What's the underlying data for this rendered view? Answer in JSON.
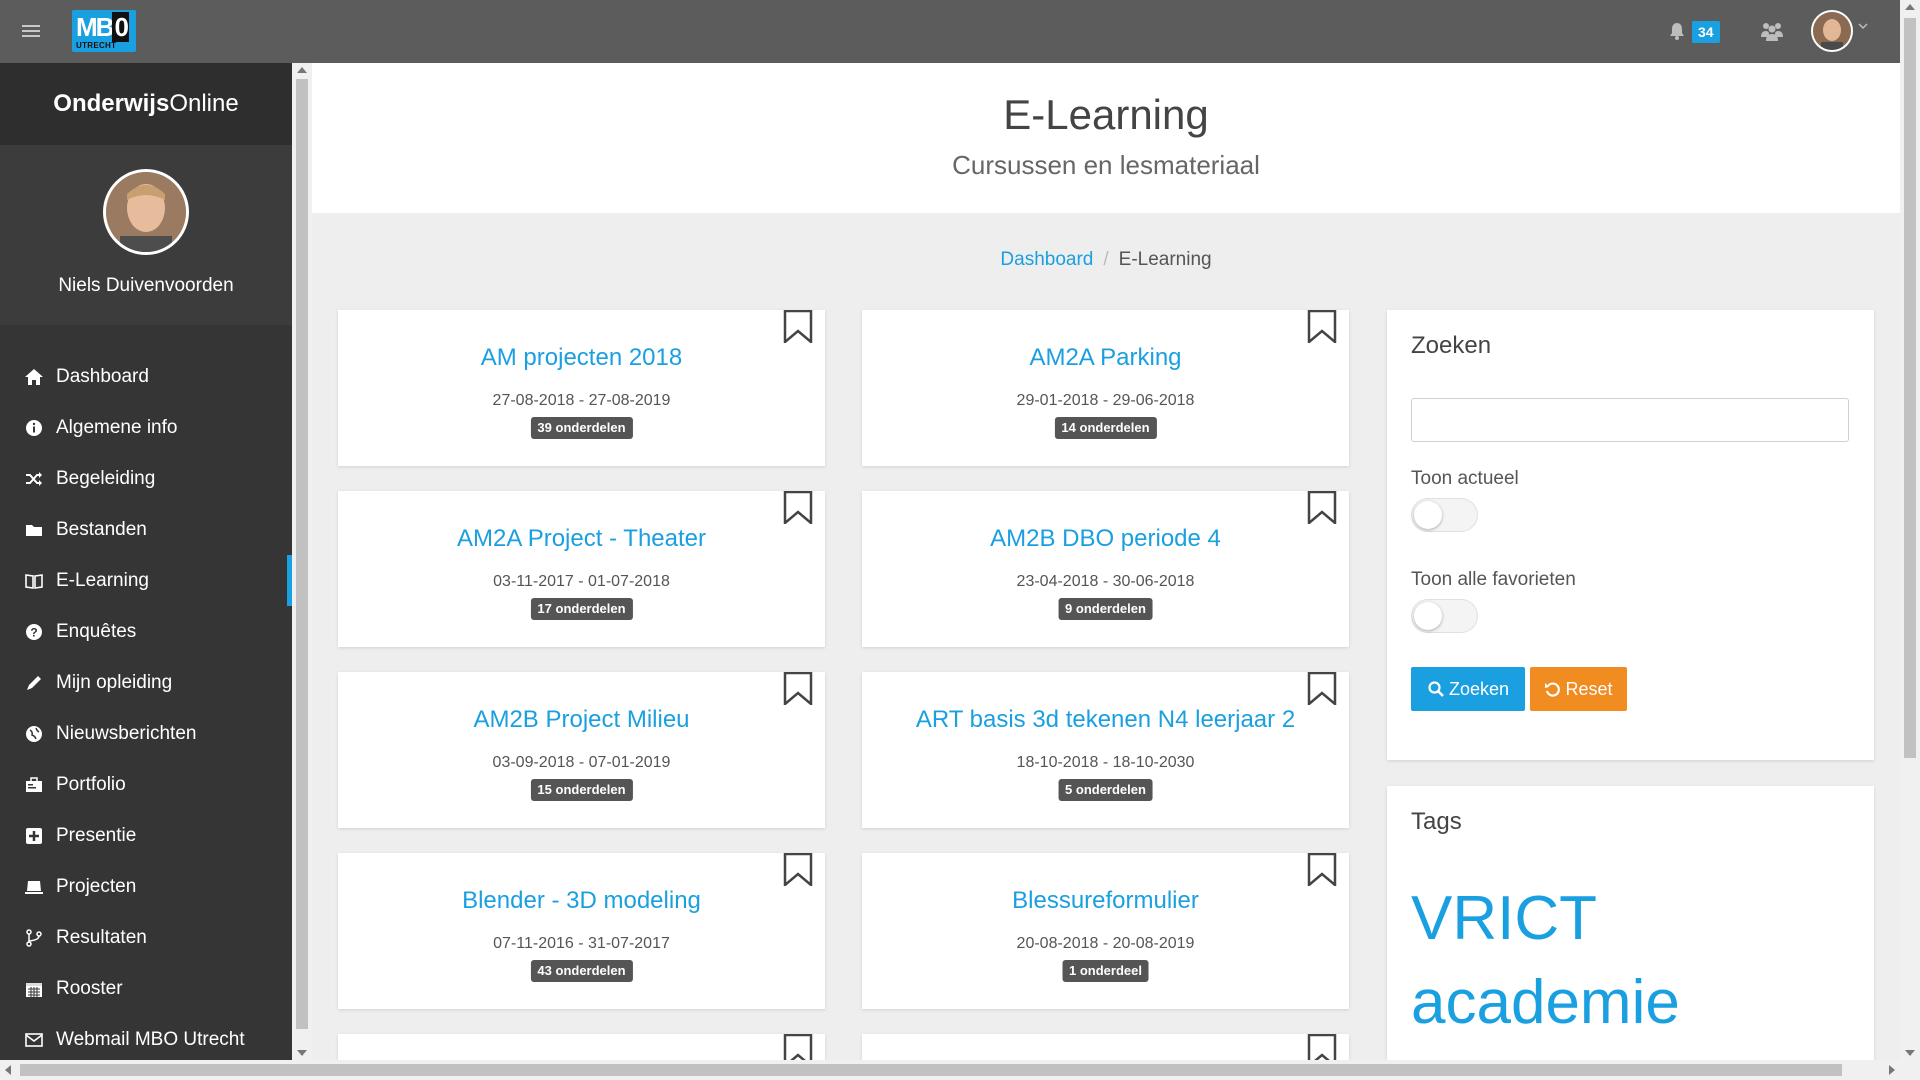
{
  "topbar": {
    "logo_text_main": "MB",
    "logo_text_zero": "0",
    "logo_text_sub": "UTRECHT",
    "notification_count": "34",
    "accent_color": "#1a9fe0",
    "icons": [
      "menu-icon",
      "bell-icon",
      "users-icon",
      "user-avatar",
      "chevron-down-icon"
    ]
  },
  "sidebar": {
    "brand_bold": "Onderwijs",
    "brand_light": "Online",
    "user_name": "Niels Duivenvoorden",
    "items": [
      {
        "label": "Dashboard",
        "icon": "home-icon"
      },
      {
        "label": "Algemene info",
        "icon": "info-icon"
      },
      {
        "label": "Begeleiding",
        "icon": "shuffle-icon"
      },
      {
        "label": "Bestanden",
        "icon": "folder-icon"
      },
      {
        "label": "E-Learning",
        "icon": "book-icon",
        "active": true
      },
      {
        "label": "Enquêtes",
        "icon": "question-icon"
      },
      {
        "label": "Mijn opleiding",
        "icon": "pencil-icon"
      },
      {
        "label": "Nieuwsberichten",
        "icon": "globe-icon"
      },
      {
        "label": "Portfolio",
        "icon": "briefcase-icon"
      },
      {
        "label": "Presentie",
        "icon": "plus-square-icon"
      },
      {
        "label": "Projecten",
        "icon": "laptop-icon"
      },
      {
        "label": "Resultaten",
        "icon": "branch-icon"
      },
      {
        "label": "Rooster",
        "icon": "calendar-icon"
      },
      {
        "label": "Webmail MBO Utrecht",
        "icon": "envelope-icon"
      }
    ]
  },
  "header": {
    "title": "E-Learning",
    "subtitle": "Cursussen en lesmateriaal"
  },
  "breadcrumb": {
    "home": "Dashboard",
    "separator": "/",
    "current": "E-Learning"
  },
  "courses": [
    {
      "title": "AM projecten 2018",
      "dates": "27-08-2018 - 27-08-2019",
      "parts": "39 onderdelen"
    },
    {
      "title": "AM2A Parking",
      "dates": "29-01-2018 - 29-06-2018",
      "parts": "14 onderdelen"
    },
    {
      "title": "AM2A Project - Theater",
      "dates": "03-11-2017 - 01-07-2018",
      "parts": "17 onderdelen"
    },
    {
      "title": "AM2B DBO periode 4",
      "dates": "23-04-2018 - 30-06-2018",
      "parts": "9 onderdelen"
    },
    {
      "title": "AM2B Project Milieu",
      "dates": "03-09-2018 - 07-01-2019",
      "parts": "15 onderdelen"
    },
    {
      "title": "ART basis 3d tekenen N4 leerjaar 2",
      "dates": "18-10-2018 - 18-10-2030",
      "parts": "5 onderdelen"
    },
    {
      "title": "Blender - 3D modeling",
      "dates": "07-11-2016 - 31-07-2017",
      "parts": "43 onderdelen"
    },
    {
      "title": "Blessureformulier",
      "dates": "20-08-2018 - 20-08-2019",
      "parts": "1 onderdeel"
    }
  ],
  "search_panel": {
    "title": "Zoeken",
    "input_value": "",
    "toggle_current_label": "Toon actueel",
    "toggle_current_on": false,
    "toggle_favorites_label": "Toon alle favorieten",
    "toggle_favorites_on": false,
    "search_button": "Zoeken",
    "reset_button": "Reset",
    "search_color": "#1a9fe0",
    "reset_color": "#f08c20"
  },
  "tags_panel": {
    "title": "Tags",
    "tags": [
      "VRICT",
      "academie"
    ]
  }
}
